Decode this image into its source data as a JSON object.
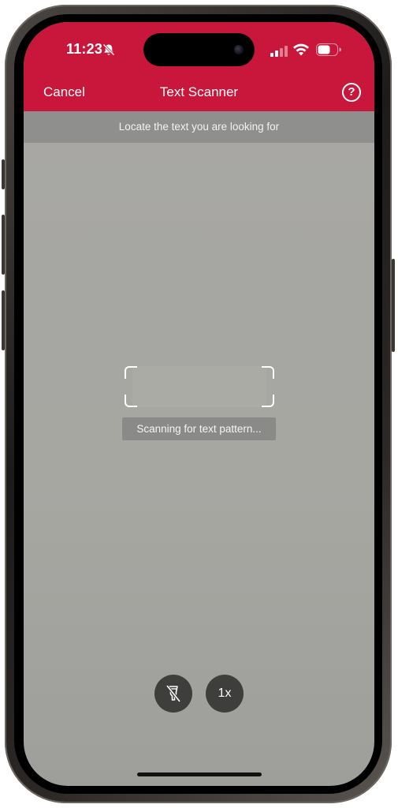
{
  "status_bar": {
    "time": "11:23",
    "silent_icon": "bell-slash-icon",
    "signal_icon": "cellular-signal-icon",
    "wifi_icon": "wifi-icon",
    "battery_icon": "battery-icon"
  },
  "nav": {
    "cancel_label": "Cancel",
    "title": "Text Scanner",
    "help_label": "?"
  },
  "banner": {
    "text": "Locate the text you are looking for"
  },
  "scanner": {
    "status_text": "Scanning for text pattern..."
  },
  "controls": {
    "flash_icon": "flashlight-off-icon",
    "zoom_label": "1x"
  },
  "colors": {
    "header_red": "#c8173a",
    "banner_gray": "#8f8f8d",
    "button_dark": "#3e3e3d"
  }
}
